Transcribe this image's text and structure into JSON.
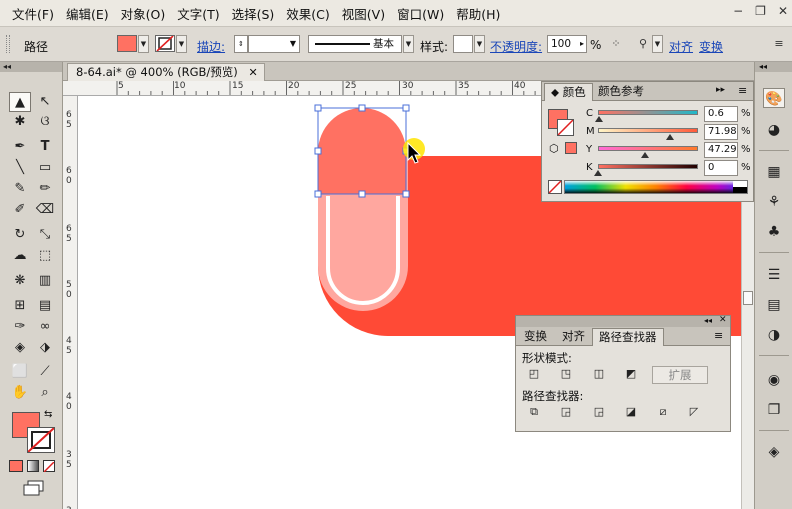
{
  "menu": {
    "items": [
      "文件(F)",
      "编辑(E)",
      "对象(O)",
      "文字(T)",
      "选择(S)",
      "效果(C)",
      "视图(V)",
      "窗口(W)",
      "帮助(H)"
    ],
    "window_controls": {
      "minimize": "−",
      "restore": "❐",
      "close": "✕"
    }
  },
  "control_bar": {
    "selection_label": "路径",
    "fill_color": "#ff7162",
    "stroke_label": "描边:",
    "stroke_style_label": "基本",
    "style_label": "样式:",
    "opacity_label": "不透明度:",
    "opacity_value": "100",
    "opacity_unit": "%",
    "align_label": "对齐",
    "transform_label": "变换"
  },
  "document": {
    "tab_title": "8-64.ai* @ 400% (RGB/预览)",
    "tab_close": "✕",
    "ruler_h": [
      "5",
      "10",
      "15",
      "20",
      "25",
      "30",
      "35",
      "40"
    ],
    "ruler_v": [
      "6",
      "5",
      "6",
      "0",
      "6",
      "5",
      "5",
      "0",
      "4",
      "5",
      "4",
      "0",
      "3",
      "5",
      "3"
    ]
  },
  "artwork": {
    "bg_shape_color": "#ff4a36",
    "pill_outer_color": "#ffa79f",
    "pill_white_stroke": "#ffffff",
    "selected_shape_color": "#ff7162",
    "selection_color": "#4a6fd8",
    "cursor_highlight": "#ffe400"
  },
  "toolbar": {
    "header": "◂◂",
    "tools": [
      {
        "name": "selection-tool",
        "glyph": "▲"
      },
      {
        "name": "direct-selection-tool",
        "glyph": "↖"
      },
      {
        "name": "magic-wand-tool",
        "glyph": "✱"
      },
      {
        "name": "lasso-tool",
        "glyph": "ଓ"
      },
      {
        "name": "pen-tool",
        "glyph": "✒"
      },
      {
        "name": "type-tool",
        "glyph": "T"
      },
      {
        "name": "line-tool",
        "glyph": "╲"
      },
      {
        "name": "rectangle-tool",
        "glyph": "▭"
      },
      {
        "name": "paintbrush-tool",
        "glyph": "✎"
      },
      {
        "name": "pencil-tool",
        "glyph": "✏"
      },
      {
        "name": "blob-brush-tool",
        "glyph": "✐"
      },
      {
        "name": "eraser-tool",
        "glyph": "⌫"
      },
      {
        "name": "rotate-tool",
        "glyph": "↻"
      },
      {
        "name": "scale-tool",
        "glyph": "⤡"
      },
      {
        "name": "warp-tool",
        "glyph": "☁"
      },
      {
        "name": "free-transform-tool",
        "glyph": "⬚"
      },
      {
        "name": "symbol-sprayer-tool",
        "glyph": "❋"
      },
      {
        "name": "column-graph-tool",
        "glyph": "▥"
      },
      {
        "name": "mesh-tool",
        "glyph": "⊞"
      },
      {
        "name": "gradient-tool",
        "glyph": "▤"
      },
      {
        "name": "eyedropper-tool",
        "glyph": "✑"
      },
      {
        "name": "blend-tool",
        "glyph": "∞"
      },
      {
        "name": "live-paint-bucket-tool",
        "glyph": "◈"
      },
      {
        "name": "live-paint-selection-tool",
        "glyph": "⬗"
      },
      {
        "name": "artboard-tool",
        "glyph": "⬜"
      },
      {
        "name": "slice-tool",
        "glyph": "⟋"
      },
      {
        "name": "hand-tool",
        "glyph": "✋"
      },
      {
        "name": "zoom-tool",
        "glyph": "⌕"
      }
    ],
    "fill_color": "#ff7162"
  },
  "color_panel": {
    "tabs": [
      "颜色",
      "颜色参考"
    ],
    "channels": [
      {
        "label": "C",
        "value": "0.6",
        "unit": "%",
        "level": 0.006
      },
      {
        "label": "M",
        "value": "71.98",
        "unit": "%",
        "level": 0.7198
      },
      {
        "label": "Y",
        "value": "47.29",
        "unit": "%",
        "level": 0.4729
      },
      {
        "label": "K",
        "value": "0",
        "unit": "%",
        "level": 0
      }
    ],
    "fill_color": "#ff7162",
    "menu_glyph": "▸▸",
    "menu_icon": "≡"
  },
  "pathfinder_panel": {
    "tabs": [
      "变换",
      "对齐",
      "路径查找器"
    ],
    "shape_modes_label": "形状模式:",
    "expand_label": "扩展",
    "pathfinders_label": "路径查找器:",
    "header_buttons": [
      "◂◂",
      "✕"
    ],
    "menu_icon": "≡"
  },
  "dock": {
    "header": "◂◂"
  }
}
